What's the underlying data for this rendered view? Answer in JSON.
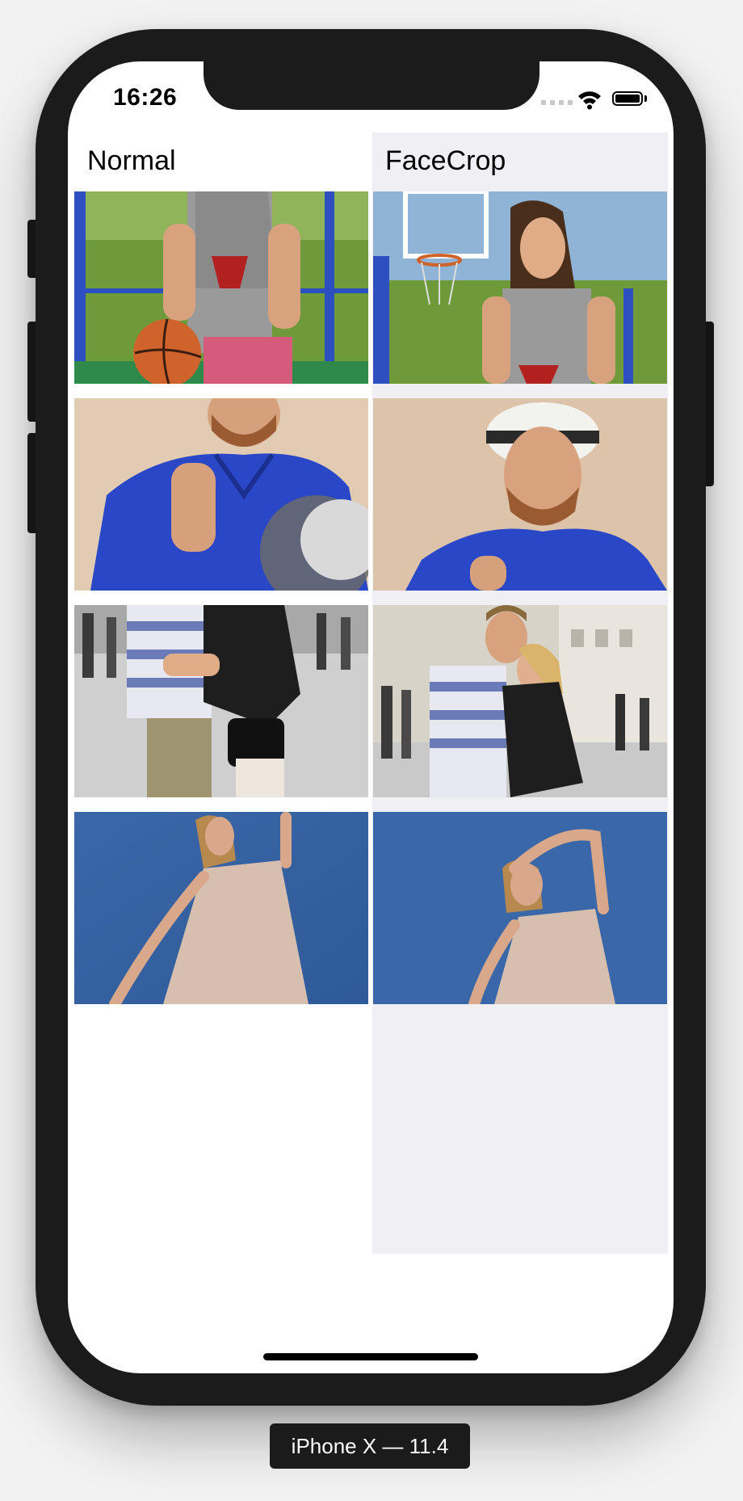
{
  "status_bar": {
    "time": "16:26"
  },
  "columns": {
    "normal": {
      "title": "Normal"
    },
    "facecrop": {
      "title": "FaceCrop"
    }
  },
  "device_label": "iPhone X — 11.4"
}
